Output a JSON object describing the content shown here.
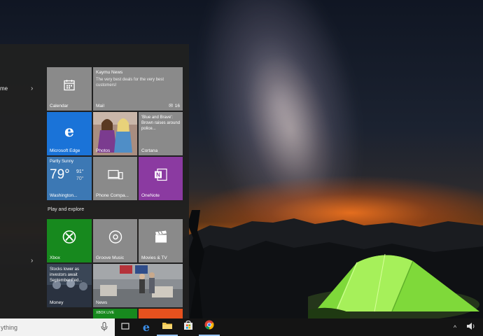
{
  "start_menu": {
    "rail_items": [
      {
        "label": "me",
        "has_chevron": true
      },
      {
        "label": "",
        "has_chevron": true
      }
    ],
    "groups": [
      {
        "title": "Play and explore"
      }
    ],
    "tiles": {
      "calendar": {
        "label": "Calendar",
        "color": "#8a8a8a",
        "icon": "calendar-icon"
      },
      "mail": {
        "label": "Mail",
        "count": "16",
        "sender": "Kaymu News",
        "preview": "The very best deals for the very best customers!",
        "color": "#8a8a8a",
        "icon": "mail-icon"
      },
      "edge": {
        "label": "Microsoft Edge",
        "color": "#1a73d8",
        "icon": "edge-icon"
      },
      "photos": {
        "label": "Photos",
        "color": "#7b6b63",
        "icon": "photos-icon"
      },
      "cortana": {
        "label": "Cortana",
        "text": "'Blue and Brave': Brown raises around police...",
        "color": "#8a8a8a"
      },
      "weather": {
        "condition": "Partly Sunny",
        "temp": "79°",
        "high": "91°",
        "low": "70°",
        "label": "Washington...",
        "color": "#3c78b4",
        "icon": "weather-icon"
      },
      "phone_companion": {
        "label": "Phone Compa...",
        "color": "#8a8a8a",
        "icon": "phone-companion-icon"
      },
      "onenote": {
        "label": "OneNote",
        "color": "#8b3aa1",
        "icon": "onenote-icon"
      },
      "xbox": {
        "label": "Xbox",
        "color": "#17891e",
        "icon": "xbox-icon"
      },
      "groove": {
        "label": "Groove Music",
        "color": "#8a8a8a",
        "icon": "groove-icon"
      },
      "movies": {
        "label": "Movies & TV",
        "color": "#8a8a8a",
        "icon": "movies-icon"
      },
      "money": {
        "label": "Money",
        "text": "Stocks lower as investors await September Fed...",
        "color": "#444"
      },
      "news": {
        "label": "News",
        "color": "#5a5a5a"
      },
      "xbox_live": {
        "text": "XBOX LIVE",
        "color": "#17891e"
      },
      "store": {
        "label": "",
        "color": "#e5511e"
      }
    }
  },
  "taskbar": {
    "search": {
      "placeholder": "ything"
    },
    "pinned": [
      {
        "name": "task-view-icon"
      },
      {
        "name": "edge-icon"
      },
      {
        "name": "file-explorer-icon"
      },
      {
        "name": "store-icon"
      },
      {
        "name": "chrome-icon"
      }
    ],
    "tray": [
      "up-chevron-icon",
      "speaker-icon"
    ]
  },
  "colors": {
    "start_bg": "#202020",
    "taskbar_bg": "#141414",
    "accent_green": "#17891e",
    "accent_blue": "#1a73d8",
    "accent_purple": "#8b3aa1"
  }
}
